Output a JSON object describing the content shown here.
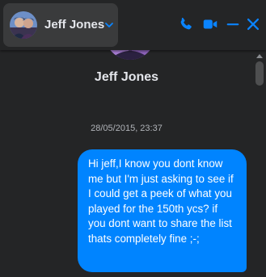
{
  "header": {
    "contact_name": "Jeff Jones",
    "icons": [
      "chevron-down-icon",
      "phone-icon",
      "video-camera-icon",
      "minimize-icon",
      "close-icon"
    ],
    "icon_color": "#0a84ff"
  },
  "conversation": {
    "profile_name": "Jeff Jones",
    "timestamp": "28/05/2015, 23:37",
    "messages": [
      {
        "sender": "me",
        "text": "Hi jeff,I know you dont know me but I'm just asking to see if I could get a peek of what you played for the 150th ycs? if you dont want to share the list thats completely fine ;-;",
        "bubble_color": "#0084ff"
      }
    ]
  },
  "colors": {
    "background": "#242526",
    "header_identity_bg": "#3a3b3c",
    "text_primary": "#e4e6eb",
    "text_secondary": "#b0b3b8"
  }
}
